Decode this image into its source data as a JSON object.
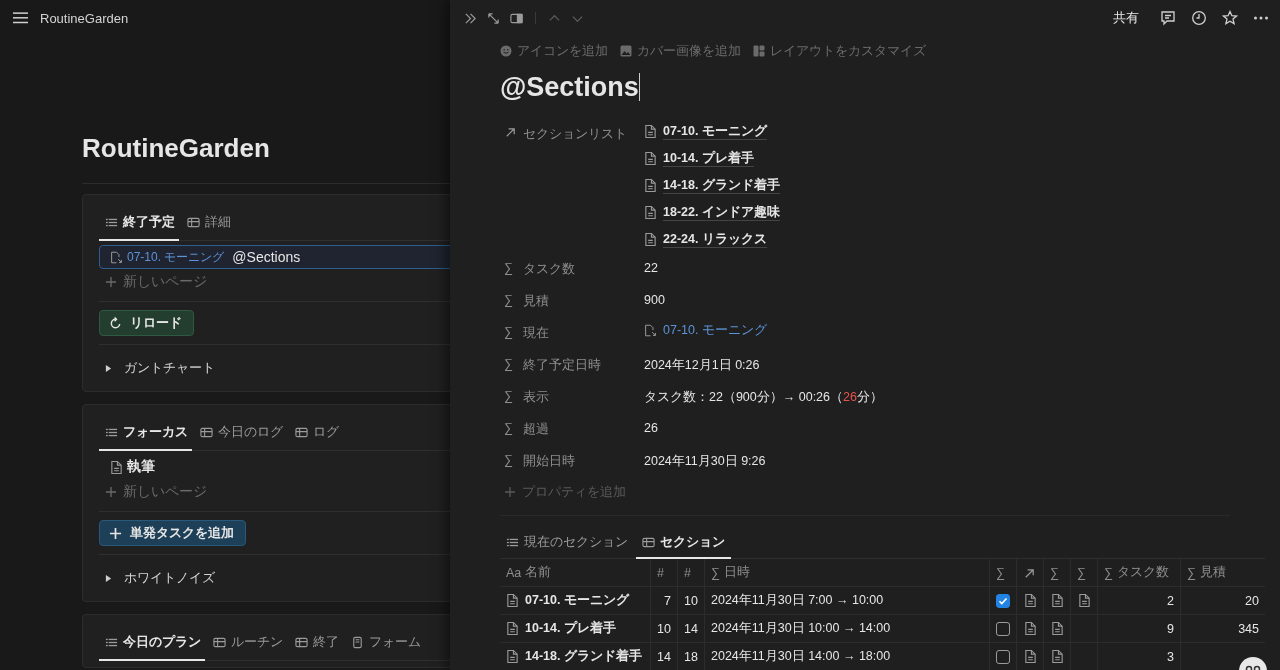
{
  "sidebar_header": {
    "title": "RoutineGarden"
  },
  "page": {
    "title": "RoutineGarden",
    "blocks": [
      {
        "tabs": [
          {
            "label": "終了予定",
            "kind": "list",
            "selected": true
          },
          {
            "label": "詳細",
            "kind": "table",
            "selected": false
          }
        ],
        "items": [
          {
            "kind": "linked",
            "link": "07-10. モーニング",
            "title": "@Sections",
            "selected": true
          }
        ],
        "new_page": "新しいページ",
        "button": {
          "label": "リロード",
          "kind": "reload"
        },
        "toggle": "ガントチャート"
      },
      {
        "tabs": [
          {
            "label": "フォーカス",
            "kind": "list",
            "selected": true
          },
          {
            "label": "今日のログ",
            "kind": "table",
            "selected": false
          },
          {
            "label": "ログ",
            "kind": "table",
            "selected": false
          }
        ],
        "items": [
          {
            "kind": "page",
            "title": "執筆",
            "selected": false
          }
        ],
        "new_page": "新しいページ",
        "button": {
          "label": "単発タスクを追加",
          "kind": "add"
        },
        "toggle": "ホワイトノイズ"
      },
      {
        "tabs": [
          {
            "label": "今日のプラン",
            "kind": "list",
            "selected": true
          },
          {
            "label": "ルーチン",
            "kind": "table",
            "selected": false
          },
          {
            "label": "終了",
            "kind": "table",
            "selected": false
          },
          {
            "label": "フォーム",
            "kind": "form",
            "selected": false
          }
        ]
      }
    ]
  },
  "peek": {
    "share": "共有",
    "page_actions": [
      {
        "label": "アイコンを追加",
        "kind": "smile"
      },
      {
        "label": "カバー画像を追加",
        "kind": "image"
      },
      {
        "label": "レイアウトをカスタマイズ",
        "kind": "layout"
      }
    ],
    "title": "@Sections",
    "properties": [
      {
        "label": "セクションリスト",
        "kind": "pages",
        "values": [
          "07-10. モーニング",
          "10-14. プレ着手",
          "14-18. グランド着手",
          "18-22. インドア趣味",
          "22-24. リラックス"
        ]
      },
      {
        "label": "タスク数",
        "symbol": "∑",
        "kind": "text",
        "value": "22"
      },
      {
        "label": "見積",
        "symbol": "∑",
        "kind": "text",
        "value": "900"
      },
      {
        "label": "現在",
        "symbol": "∑",
        "kind": "link",
        "value": "07-10. モーニング"
      },
      {
        "label": "終了予定日時",
        "symbol": "∑",
        "kind": "text",
        "value": "2024年12月1日 0:26"
      },
      {
        "label": "表示",
        "symbol": "∑",
        "kind": "parts",
        "parts": [
          {
            "text": "タスク数：22（900分）→ 00:26（"
          },
          {
            "text": "26",
            "color": "#e5534b"
          },
          {
            "text": "分）"
          }
        ]
      },
      {
        "label": "超過",
        "symbol": "∑",
        "kind": "text",
        "value": "26"
      },
      {
        "label": "開始日時",
        "symbol": "∑",
        "kind": "text",
        "value": "2024年11月30日 9:26"
      }
    ],
    "add_property": "プロパティを追加",
    "views": [
      {
        "label": "現在のセクション",
        "kind": "list",
        "selected": false
      },
      {
        "label": "セクション",
        "kind": "table",
        "selected": true
      }
    ],
    "table": {
      "columns": [
        {
          "symbol": "Aa",
          "label": "名前",
          "kind": "title"
        },
        {
          "symbol": "#",
          "kind": "num"
        },
        {
          "symbol": "#",
          "kind": "num"
        },
        {
          "symbol": "∑",
          "label": "日時",
          "kind": "date"
        },
        {
          "symbol": "∑",
          "kind": "check"
        },
        {
          "kind": "relation"
        },
        {
          "symbol": "∑",
          "kind": "link"
        },
        {
          "symbol": "∑",
          "kind": "link"
        },
        {
          "symbol": "∑",
          "label": "タスク数",
          "kind": "num"
        },
        {
          "symbol": "∑",
          "label": "見積",
          "kind": "num"
        }
      ],
      "rows": [
        {
          "cells": [
            "07-10. モーニング",
            "7",
            "10",
            "2024年11月30日 7:00 → 10:00",
            true,
            true,
            true,
            true,
            "2",
            "20"
          ]
        },
        {
          "cells": [
            "10-14. プレ着手",
            "10",
            "14",
            "2024年11月30日 10:00 → 14:00",
            false,
            true,
            true,
            false,
            "9",
            "345"
          ]
        },
        {
          "cells": [
            "14-18. グランド着手",
            "14",
            "18",
            "2024年11月30日 14:00 → 18:00",
            false,
            true,
            true,
            false,
            "3",
            null
          ]
        }
      ]
    }
  }
}
